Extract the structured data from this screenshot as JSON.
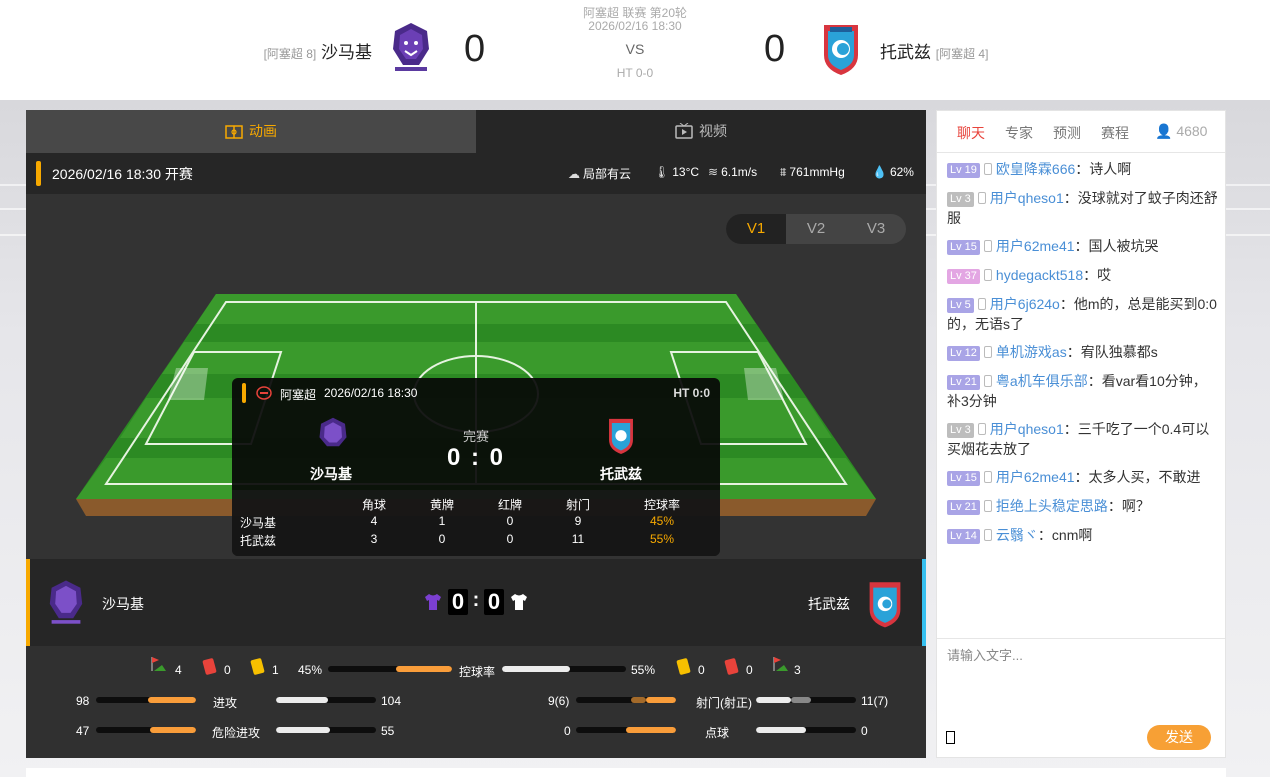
{
  "header": {
    "league_line": "阿塞超 联赛 第20轮",
    "datetime": "2026/02/16 18:30",
    "vs": "VS",
    "ht": "HT 0-0",
    "home": {
      "rank": "[阿塞超 8]",
      "name": "沙马基",
      "score": "0"
    },
    "away": {
      "name": "托武兹",
      "rank": "[阿塞超 4]",
      "score": "0"
    }
  },
  "tabs": {
    "animation": "动画",
    "video": "视频"
  },
  "info": {
    "kickoff": "2026/02/16 18:30 开赛",
    "weather": "局部有云",
    "temperature": "13°C",
    "wind": "6.1m/s",
    "pressure": "761mmHg",
    "humidity": "62%"
  },
  "versions": [
    "V1",
    "V2",
    "V3"
  ],
  "popup": {
    "league": "阿塞超",
    "datetime": "2026/02/16 18:30",
    "ht": "HT 0:0",
    "status": "完赛",
    "score": "0 : 0",
    "home_name": "沙马基",
    "away_name": "托武兹",
    "headers": [
      "角球",
      "黄牌",
      "红牌",
      "射门",
      "控球率"
    ],
    "rows": [
      {
        "team": "沙马基",
        "values": [
          "4",
          "1",
          "0",
          "9",
          "45%"
        ]
      },
      {
        "team": "托武兹",
        "values": [
          "3",
          "0",
          "0",
          "11",
          "55%"
        ]
      }
    ]
  },
  "teambar": {
    "home_name": "沙马基",
    "away_name": "托武兹",
    "home_score": "0",
    "away_score": "0"
  },
  "stats": {
    "home_corners": "4",
    "home_red": "0",
    "home_yellow": "1",
    "possession_label": "控球率",
    "home_possession": "45%",
    "away_possession": "55%",
    "home_possession_frac": 0.45,
    "away_possession_frac": 0.55,
    "away_yellow": "0",
    "away_red": "0",
    "away_corners": "3",
    "attack": {
      "label": "进攻",
      "home": "98",
      "away": "104"
    },
    "danger": {
      "label": "危险进攻",
      "home": "47",
      "away": "55"
    },
    "shots": {
      "label": "射门(射正)",
      "home": "9(6)",
      "away": "11(7)"
    },
    "penalty": {
      "label": "点球",
      "home": "0",
      "away": "0"
    }
  },
  "chat": {
    "tabs": [
      "聊天",
      "专家",
      "预测",
      "赛程"
    ],
    "online": "4680",
    "messages": [
      {
        "level": "Lv 19",
        "user": "欧皇降霖666",
        "text": "诗人啊",
        "color": "#a9a4e6"
      },
      {
        "level": "Lv 3",
        "user": "用户qheso1",
        "text": "没球就对了蚊子肉还舒服",
        "color": "#bdbdbd"
      },
      {
        "level": "Lv 15",
        "user": "用户62me41",
        "text": "国人被坑哭",
        "color": "#a9a4e6"
      },
      {
        "level": "Lv 37",
        "user": "hydegackt518",
        "text": "哎",
        "color": "#e3a6e3"
      },
      {
        "level": "Lv 5",
        "user": "用户6j624o",
        "text": "他m的，总是能买到0:0的，无语s了",
        "color": "#a9a4e6"
      },
      {
        "level": "Lv 12",
        "user": "单机游戏as",
        "text": "宥队独慕都s",
        "color": "#a9a4e6"
      },
      {
        "level": "Lv 21",
        "user": "粤a机车俱乐部",
        "text": "看var看10分钟，补3分钟",
        "color": "#a9a4e6"
      },
      {
        "level": "Lv 3",
        "user": "用户qheso1",
        "text": "三千吃了一个0.4可以买烟花去放了",
        "color": "#bdbdbd"
      },
      {
        "level": "Lv 15",
        "user": "用户62me41",
        "text": "太多人买，不敢进",
        "color": "#a9a4e6"
      },
      {
        "level": "Lv 21",
        "user": "拒绝上头稳定思路",
        "text": "啊？",
        "color": "#a9a4e6"
      },
      {
        "level": "Lv 14",
        "user": "云翳ヾ",
        "text": "cnm啊",
        "color": "#a9a4e6"
      }
    ],
    "placeholder": "请输入文字...",
    "send": "发送"
  }
}
